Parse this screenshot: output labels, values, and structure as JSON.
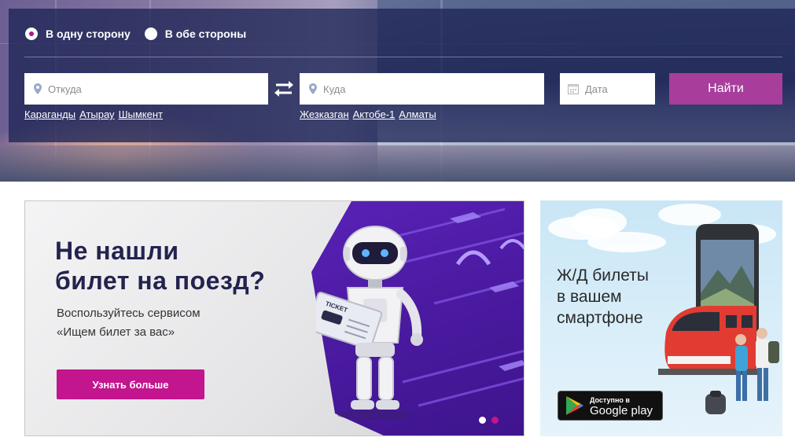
{
  "search": {
    "trip_type": {
      "one_way": "В одну сторону",
      "round_trip": "В обе стороны",
      "selected": "one_way"
    },
    "from_placeholder": "Откуда",
    "to_placeholder": "Куда",
    "date_placeholder": "Дата",
    "find_button": "Найти",
    "quick_from": [
      "Караганды",
      "Атырау",
      "Шымкент"
    ],
    "quick_to": [
      "Жезказган",
      "Актобе-1",
      "Алматы"
    ]
  },
  "promo": {
    "title_line1": "Не нашли",
    "title_line2": "билет на поезд?",
    "subtitle_line1": "Воспользуйтесь сервисом",
    "subtitle_line2": "«Ищем билет за вас»",
    "button": "Узнать больше",
    "ticket_label": "TICKET",
    "slides": 2,
    "active_slide": 2
  },
  "app_banner": {
    "line1": "Ж/Д билеты",
    "line2": "в вашем",
    "line3": "смартфоне",
    "store_small": "Доступно в",
    "store_big": "Google play"
  },
  "colors": {
    "accent": "#a93d9c",
    "promo_button": "#c2158e",
    "title": "#23234f",
    "overlay": "#1e2555"
  },
  "icons": [
    "radio-icon",
    "location-pin-icon",
    "swap-icon",
    "calendar-icon",
    "google-play-icon",
    "robot-illustration",
    "train-illustration"
  ]
}
